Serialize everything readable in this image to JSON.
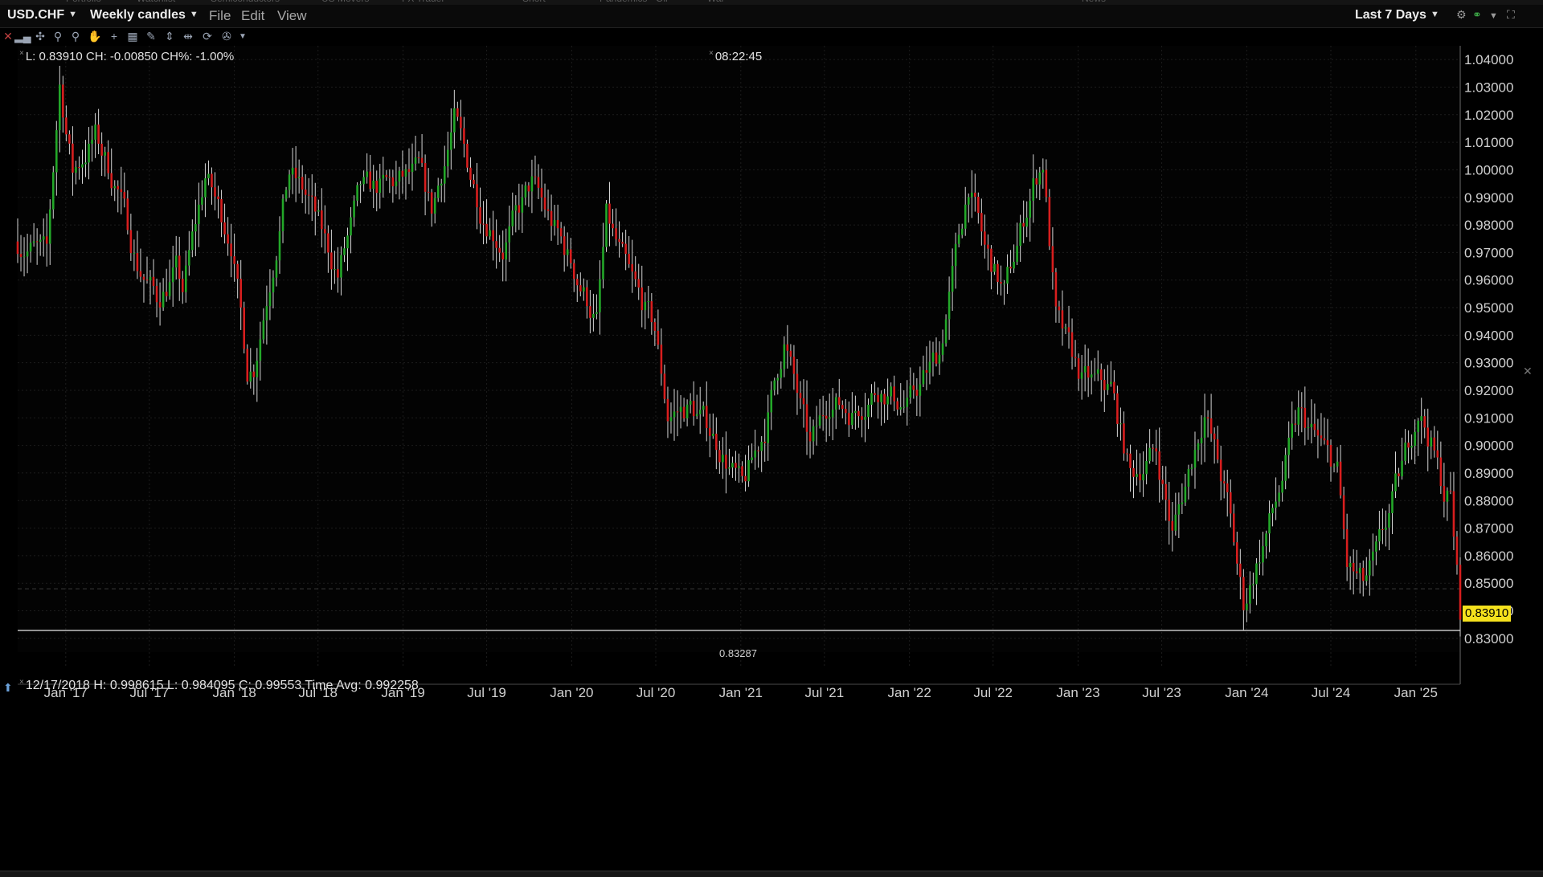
{
  "header": {
    "symbol": "USD.CHF",
    "period": "Weekly candles",
    "menus": [
      "File",
      "Edit",
      "View"
    ],
    "range": "Last 7 Days"
  },
  "top_tabs": [
    "Portfolio",
    "Watchlist",
    "Semiconductors",
    "US Movers",
    "FX Trader",
    "Short",
    "Pandemics",
    "Oil",
    "War",
    "News"
  ],
  "info": {
    "last_readout": "L: 0.83910 CH: -0.00850 CH%: -1.00%",
    "clock": "08:22:45",
    "bar_readout": "12/17/2018 H: 0.998615 L: 0.984095 C: 0.99553 Time Avg: 0.992258",
    "low_marker": "0.83287",
    "last_price": "0.83910"
  },
  "icons": {
    "toolbar": [
      "close-icon",
      "bar-chart-icon",
      "crosshair-icon",
      "zoom-in-icon",
      "zoom-out-icon",
      "hand-icon",
      "cross-icon",
      "studies-icon",
      "draw-icon",
      "split-icon",
      "align-icon",
      "refresh-icon",
      "wrench-icon",
      "dropdown-icon"
    ],
    "header_right": [
      "gear-icon",
      "link-icon",
      "menu-icon",
      "maximize-icon"
    ]
  },
  "colors": {
    "background": "#000000",
    "up_candle": "#23a829",
    "down_candle": "#d81e1e",
    "wick": "#d5d5d5",
    "grid": "#1d1d1d",
    "last_price_bg": "#f5e11d"
  },
  "chart_data": {
    "type": "candlestick",
    "title": "",
    "xlabel": "",
    "ylabel": "",
    "x_ticks": [
      "Jan '17",
      "Jul '17",
      "Jan '18",
      "Jul '18",
      "Jan '19",
      "Jul '19",
      "Jan '20",
      "Jul '20",
      "Jan '21",
      "Jul '21",
      "Jan '22",
      "Jul '22",
      "Jan '23",
      "Jul '23",
      "Jan '24",
      "Jul '24",
      "Jan '25"
    ],
    "y_ticks": [
      "1.04000",
      "1.03000",
      "1.02000",
      "1.01000",
      "1.00000",
      "0.99000",
      "0.98000",
      "0.97000",
      "0.96000",
      "0.95000",
      "0.94000",
      "0.93000",
      "0.92000",
      "0.91000",
      "0.90000",
      "0.89000",
      "0.88000",
      "0.87000",
      "0.86000",
      "0.85000",
      "0.84000",
      "0.83000"
    ],
    "ylim": [
      0.825,
      1.045
    ],
    "grid": true,
    "x_range": [
      "2016-09-19",
      "2025-04-07"
    ],
    "reference_lines": [
      0.83287,
      0.848
    ],
    "close_path": [
      [
        "2016-09-19",
        0.974
      ],
      [
        "2016-11-21",
        0.969
      ],
      [
        "2016-12-19",
        1.031
      ],
      [
        "2017-01-16",
        0.999
      ],
      [
        "2017-03-06",
        1.012
      ],
      [
        "2017-04-24",
        0.993
      ],
      [
        "2017-06-05",
        0.966
      ],
      [
        "2017-07-17",
        0.953
      ],
      [
        "2017-08-28",
        0.963
      ],
      [
        "2017-09-11",
        0.956
      ],
      [
        "2017-10-30",
        0.998
      ],
      [
        "2017-12-25",
        0.975
      ],
      [
        "2018-01-29",
        0.928
      ],
      [
        "2018-02-12",
        0.929
      ],
      [
        "2018-04-30",
        0.999
      ],
      [
        "2018-06-11",
        0.989
      ],
      [
        "2018-08-13",
        0.962
      ],
      [
        "2018-10-01",
        0.992
      ],
      [
        "2018-12-17",
        0.995
      ],
      [
        "2019-02-04",
        0.999
      ],
      [
        "2019-03-04",
        0.985
      ],
      [
        "2019-04-22",
        1.018
      ],
      [
        "2019-06-17",
        0.987
      ],
      [
        "2019-08-05",
        0.972
      ],
      [
        "2019-10-07",
        0.995
      ],
      [
        "2019-12-23",
        0.969
      ],
      [
        "2020-02-24",
        0.945
      ],
      [
        "2020-03-16",
        0.982
      ],
      [
        "2020-05-04",
        0.961
      ],
      [
        "2020-06-29",
        0.942
      ],
      [
        "2020-07-27",
        0.911
      ],
      [
        "2020-09-14",
        0.914
      ],
      [
        "2020-10-26",
        0.906
      ],
      [
        "2021-01-04",
        0.884
      ],
      [
        "2021-02-22",
        0.906
      ],
      [
        "2021-04-05",
        0.938
      ],
      [
        "2021-05-31",
        0.899
      ],
      [
        "2021-07-12",
        0.917
      ],
      [
        "2021-08-30",
        0.912
      ],
      [
        "2021-10-25",
        0.921
      ],
      [
        "2021-12-27",
        0.914
      ],
      [
        "2022-03-07",
        0.934
      ],
      [
        "2022-05-09",
        0.995
      ],
      [
        "2022-06-13",
        0.971
      ],
      [
        "2022-07-25",
        0.955
      ],
      [
        "2022-09-26",
        0.995
      ],
      [
        "2022-10-17",
        1.003
      ],
      [
        "2022-11-14",
        0.946
      ],
      [
        "2023-01-09",
        0.924
      ],
      [
        "2023-03-13",
        0.921
      ],
      [
        "2023-04-24",
        0.889
      ],
      [
        "2023-06-19",
        0.898
      ],
      [
        "2023-07-24",
        0.868
      ],
      [
        "2023-10-02",
        0.913
      ],
      [
        "2023-11-20",
        0.879
      ],
      [
        "2023-12-25",
        0.842
      ],
      [
        "2024-03-04",
        0.879
      ],
      [
        "2024-04-22",
        0.911
      ],
      [
        "2024-05-20",
        0.905
      ],
      [
        "2024-07-15",
        0.891
      ],
      [
        "2024-08-05",
        0.856
      ],
      [
        "2024-09-09",
        0.849
      ],
      [
        "2024-10-07",
        0.859
      ],
      [
        "2024-11-11",
        0.879
      ],
      [
        "2025-01-06",
        0.914
      ],
      [
        "2025-02-03",
        0.901
      ],
      [
        "2025-03-03",
        0.883
      ],
      [
        "2025-03-17",
        0.881
      ],
      [
        "2025-04-07",
        0.8391
      ]
    ]
  }
}
